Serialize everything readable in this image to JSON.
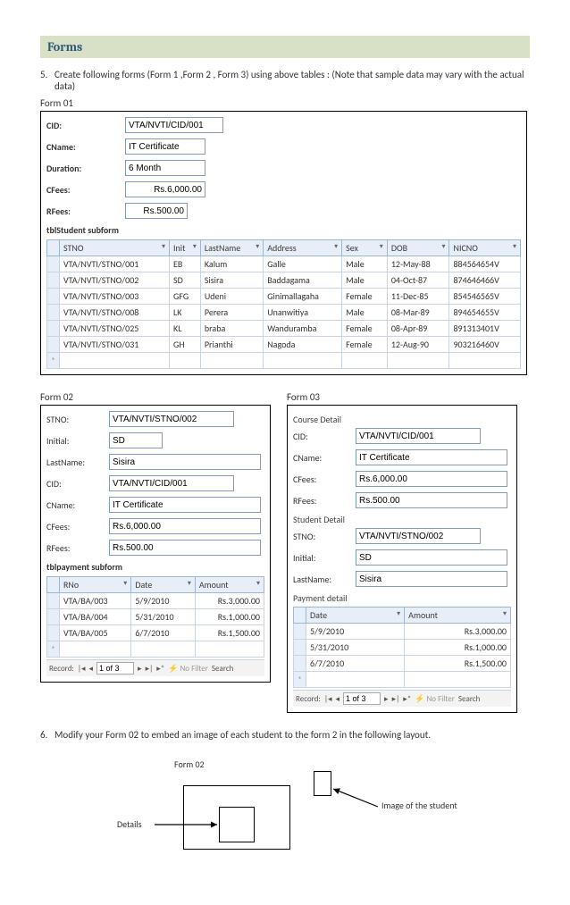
{
  "header": "Forms",
  "q5": {
    "num": "5.",
    "text": "Create following forms (Form 1 ,Form 2 , Form 3) using above tables : (Note that sample data may vary with the actual data)"
  },
  "form01": {
    "title": "Form 01",
    "fields": {
      "cid_label": "CID:",
      "cid_value": "VTA/NVTI/CID/001",
      "cname_label": "CName:",
      "cname_value": "IT Certificate",
      "duration_label": "Duration:",
      "duration_value": "6 Month",
      "cfees_label": "CFees:",
      "cfees_value": "Rs.6,000.00",
      "rfees_label": "RFees:",
      "rfees_value": "Rs.500.00"
    },
    "subform_title": "tblStudent subform",
    "columns": [
      "STNO",
      "Init",
      "LastName",
      "Address",
      "Sex",
      "DOB",
      "NICNO"
    ],
    "rows": [
      [
        "VTA/NVTI/STNO/001",
        "EB",
        "Kalum",
        "Galle",
        "Male",
        "12-May-88",
        "884564654V"
      ],
      [
        "VTA/NVTI/STNO/002",
        "SD",
        "Sisira",
        "Baddagama",
        "Male",
        "04-Oct-87",
        "874646466V"
      ],
      [
        "VTA/NVTI/STNO/003",
        "GFG",
        "Udeni",
        "Ginimallagaha",
        "Female",
        "11-Dec-85",
        "854546565V"
      ],
      [
        "VTA/NVTI/STNO/008",
        "LK",
        "Perera",
        "Unanwitiya",
        "Male",
        "08-Mar-89",
        "894654655V"
      ],
      [
        "VTA/NVTI/STNO/025",
        "KL",
        "braba",
        "Wanduramba",
        "Female",
        "08-Apr-89",
        "891313401V"
      ],
      [
        "VTA/NVTI/STNO/031",
        "GH",
        "Prianthi",
        "Nagoda",
        "Female",
        "12-Aug-90",
        "903216460V"
      ]
    ]
  },
  "form02": {
    "title": "Form 02",
    "fields": {
      "stno_label": "STNO:",
      "stno_value": "VTA/NVTI/STNO/002",
      "initial_label": "Initial:",
      "initial_value": "SD",
      "lastname_label": "LastName:",
      "lastname_value": "Sisira",
      "cid_label": "CID:",
      "cid_value": "VTA/NVTI/CID/001",
      "cname_label": "CName:",
      "cname_value": "IT Certificate",
      "cfees_label": "CFees:",
      "cfees_value": "Rs.6,000.00",
      "rfees_label": "RFees:",
      "rfees_value": "Rs.500.00"
    },
    "subform_title": "tblpayment subform",
    "columns": [
      "RNo",
      "Date",
      "Amount"
    ],
    "rows": [
      [
        "VTA/BA/003",
        "5/9/2010",
        "Rs.3,000.00"
      ],
      [
        "VTA/BA/004",
        "5/31/2010",
        "Rs.1,000.00"
      ],
      [
        "VTA/BA/005",
        "6/7/2010",
        "Rs.1,500.00"
      ]
    ],
    "nav": {
      "label": "Record:",
      "pos": "1 of 3",
      "nofilter": "No Filter",
      "search": "Search"
    }
  },
  "form03": {
    "title": "Form 03",
    "course_label": "Course Detail",
    "course": {
      "cid_label": "CID:",
      "cid_value": "VTA/NVTI/CID/001",
      "cname_label": "CName:",
      "cname_value": "IT Certificate",
      "cfees_label": "CFees:",
      "cfees_value": "Rs.6,000.00",
      "rfees_label": "RFees:",
      "rfees_value": "Rs.500.00"
    },
    "student_label": "Student Detail",
    "student": {
      "stno_label": "STNO:",
      "stno_value": "VTA/NVTI/STNO/002",
      "initial_label": "Initial:",
      "initial_value": "SD",
      "lastname_label": "LastName:",
      "lastname_value": "Sisira"
    },
    "payment_label": "Payment detail",
    "columns": [
      "Date",
      "Amount"
    ],
    "rows": [
      [
        "5/9/2010",
        "Rs.3,000.00"
      ],
      [
        "5/31/2010",
        "Rs.1,000.00"
      ],
      [
        "6/7/2010",
        "Rs.1,500.00"
      ]
    ],
    "nav": {
      "label": "Record:",
      "pos": "1 of 3",
      "nofilter": "No Filter",
      "search": "Search"
    }
  },
  "q6": {
    "num": "6.",
    "text": "Modify your Form  02  to embed an image of each student to the form 2 in the following layout."
  },
  "diagram": {
    "form02": "Form 02",
    "details": "Details",
    "image": "Image of  the student"
  }
}
